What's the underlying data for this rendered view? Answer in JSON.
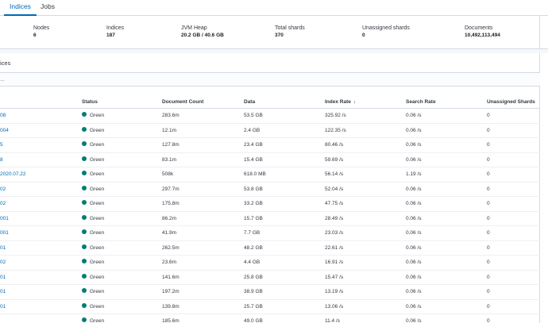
{
  "tabs": [
    {
      "label": "Indices",
      "active": true
    },
    {
      "label": "Jobs",
      "active": false
    }
  ],
  "stats": [
    {
      "label": "Nodes",
      "value": "6"
    },
    {
      "label": "Indices",
      "value": "187"
    },
    {
      "label": "JVM Heap",
      "value": "20.2 GB / 40.6 GB"
    },
    {
      "label": "Total shards",
      "value": "370"
    },
    {
      "label": "Unassigned shards",
      "value": "0"
    },
    {
      "label": "Documents",
      "value": "10,492,113,494"
    }
  ],
  "panel": {
    "title": "ices",
    "filter_placeholder": "..."
  },
  "table": {
    "columns": [
      "",
      "Status",
      "Document Count",
      "Data",
      "Index Rate",
      "Search Rate",
      "Unassigned Shards"
    ],
    "sort_arrow": "↓",
    "rows": [
      {
        "name": "08",
        "status": "Green",
        "doc_count": "283.6m",
        "data": "53.5 GB",
        "index_rate": "325.92 /s",
        "search_rate": "0.06 /s",
        "unassigned": "0"
      },
      {
        "name": "004",
        "status": "Green",
        "doc_count": "12.1m",
        "data": "2.4 GB",
        "index_rate": "122.35 /s",
        "search_rate": "0.06 /s",
        "unassigned": "0"
      },
      {
        "name": "5",
        "status": "Green",
        "doc_count": "127.8m",
        "data": "23.4 GB",
        "index_rate": "80.46 /s",
        "search_rate": "0.06 /s",
        "unassigned": "0"
      },
      {
        "name": "8",
        "status": "Green",
        "doc_count": "83.1m",
        "data": "15.4 GB",
        "index_rate": "59.69 /s",
        "search_rate": "0.06 /s",
        "unassigned": "0"
      },
      {
        "name": "2020.07.22",
        "status": "Green",
        "doc_count": "508k",
        "data": "618.0 MB",
        "index_rate": "56.14 /s",
        "search_rate": "1.19 /s",
        "unassigned": "0"
      },
      {
        "name": "02",
        "status": "Green",
        "doc_count": "297.7m",
        "data": "53.8 GB",
        "index_rate": "52.04 /s",
        "search_rate": "0.06 /s",
        "unassigned": "0"
      },
      {
        "name": "02",
        "status": "Green",
        "doc_count": "175.8m",
        "data": "33.2 GB",
        "index_rate": "47.75 /s",
        "search_rate": "0.06 /s",
        "unassigned": "0"
      },
      {
        "name": "001",
        "status": "Green",
        "doc_count": "86.2m",
        "data": "15.7 GB",
        "index_rate": "28.49 /s",
        "search_rate": "0.06 /s",
        "unassigned": "0"
      },
      {
        "name": "001",
        "status": "Green",
        "doc_count": "41.9m",
        "data": "7.7 GB",
        "index_rate": "23.03 /s",
        "search_rate": "0.06 /s",
        "unassigned": "0"
      },
      {
        "name": "01",
        "status": "Green",
        "doc_count": "262.5m",
        "data": "48.2 GB",
        "index_rate": "22.61 /s",
        "search_rate": "0.06 /s",
        "unassigned": "0"
      },
      {
        "name": "02",
        "status": "Green",
        "doc_count": "23.6m",
        "data": "4.4 GB",
        "index_rate": "16.91 /s",
        "search_rate": "0.06 /s",
        "unassigned": "0"
      },
      {
        "name": "01",
        "status": "Green",
        "doc_count": "141.6m",
        "data": "25.8 GB",
        "index_rate": "15.47 /s",
        "search_rate": "0.06 /s",
        "unassigned": "0"
      },
      {
        "name": "01",
        "status": "Green",
        "doc_count": "197.2m",
        "data": "38.9 GB",
        "index_rate": "13.19 /s",
        "search_rate": "0.06 /s",
        "unassigned": "0"
      },
      {
        "name": "01",
        "status": "Green",
        "doc_count": "139.8m",
        "data": "25.7 GB",
        "index_rate": "13.06 /s",
        "search_rate": "0.06 /s",
        "unassigned": "0"
      },
      {
        "name": "",
        "status": "Green",
        "doc_count": "185.6m",
        "data": "49.0 GB",
        "index_rate": "11.4 /s",
        "search_rate": "0.06 /s",
        "unassigned": "0"
      }
    ]
  },
  "colors": {
    "accent": "#006bb4",
    "status_green": "#017d73",
    "border": "#d3dae6"
  }
}
